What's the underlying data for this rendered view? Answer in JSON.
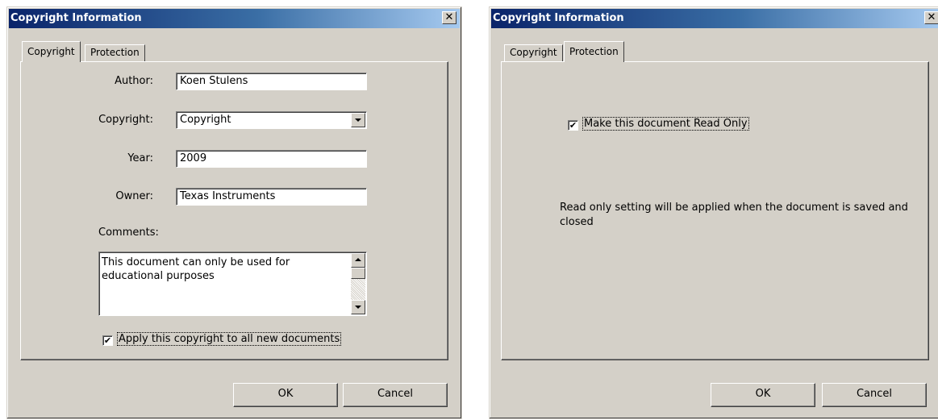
{
  "left_dialog": {
    "title": "Copyright Information",
    "close_glyph": "✕",
    "tabs": [
      {
        "label": "Copyright",
        "active": true
      },
      {
        "label": "Protection",
        "active": false
      }
    ],
    "fields": {
      "author": {
        "label": "Author:",
        "value": "Koen Stulens"
      },
      "copyright": {
        "label": "Copyright:",
        "value": "Copyright"
      },
      "year": {
        "label": "Year:",
        "value": "2009"
      },
      "owner": {
        "label": "Owner:",
        "value": "Texas Instruments"
      }
    },
    "comments_label": "Comments:",
    "comments_value": "This document can only be used for educational purposes",
    "apply_checkbox": {
      "label": "Apply this copyright to all new documents",
      "checked": true
    },
    "ok_label": "OK",
    "cancel_label": "Cancel"
  },
  "right_dialog": {
    "title": "Copyright Information",
    "close_glyph": "✕",
    "tabs": [
      {
        "label": "Copyright",
        "active": false
      },
      {
        "label": "Protection",
        "active": true
      }
    ],
    "read_only_checkbox": {
      "label": "Make this document Read Only",
      "checked": true
    },
    "note": "Read only setting will be applied when the document is saved and closed",
    "ok_label": "OK",
    "cancel_label": "Cancel"
  },
  "colors": {
    "dialog_bg": "#d4d0c8",
    "title_gradient_start": "#0a246a",
    "title_gradient_end": "#a6caf0"
  },
  "check_glyph": "✔",
  "icons": {
    "close": "close-icon",
    "combo_arrow": "chevron-down-icon",
    "scroll_up": "arrow-up-icon",
    "scroll_down": "arrow-down-icon",
    "check": "check-icon"
  }
}
